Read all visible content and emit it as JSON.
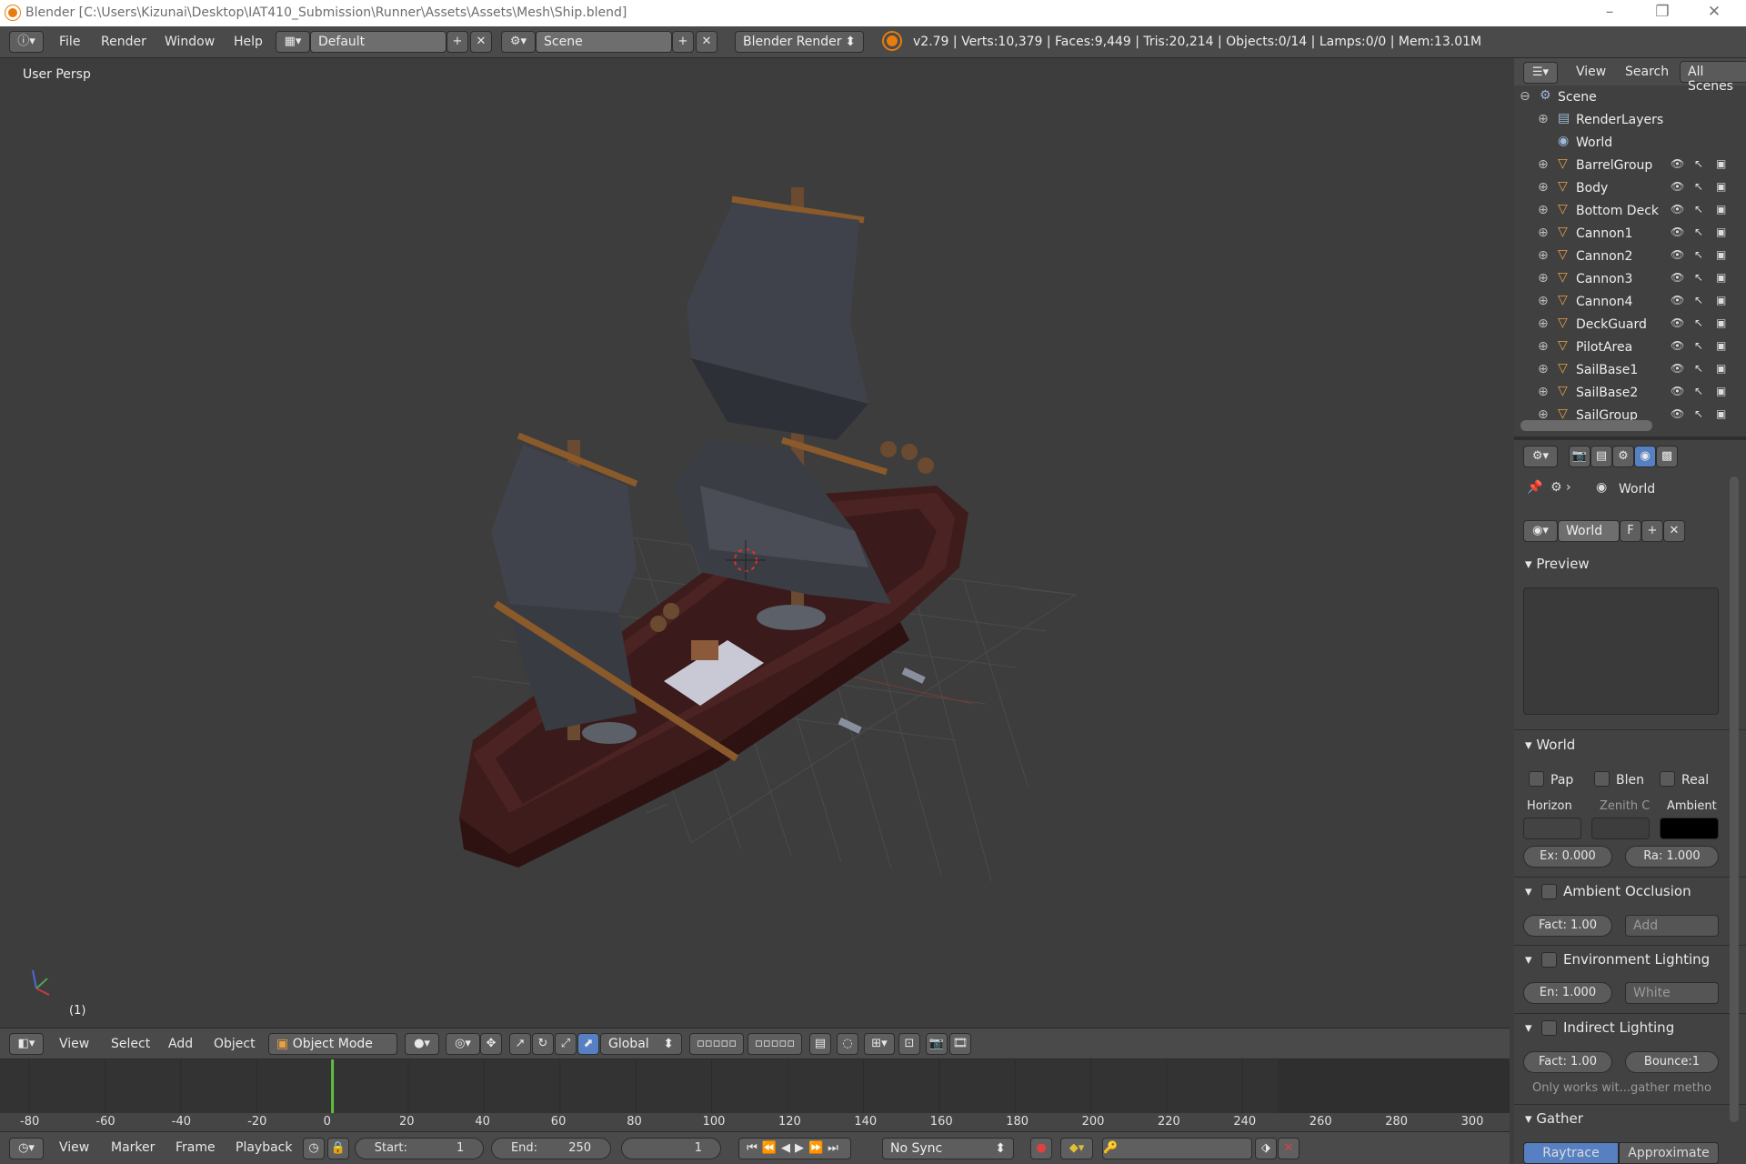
{
  "window": {
    "title": "Blender [C:\\Users\\Kizunai\\Desktop\\IAT410_Submission\\Runner\\Assets\\Assets\\Mesh\\Ship.blend]",
    "min": "–",
    "max": "❐",
    "close": "✕"
  },
  "menu": {
    "file": "File",
    "render": "Render",
    "window": "Window",
    "help": "Help"
  },
  "layout": {
    "screen": "Default",
    "scene": "Scene",
    "engine": "Blender Render"
  },
  "stats": "v2.79 | Verts:10,379 | Faces:9,449 | Tris:20,214 | Objects:0/14 | Lamps:0/0 | Mem:13.01M",
  "viewport": {
    "label": "User Persp",
    "frame": "(1)"
  },
  "vpheader": {
    "view": "View",
    "select": "Select",
    "add": "Add",
    "object": "Object",
    "mode": "Object Mode",
    "orientation": "Global"
  },
  "timeline": {
    "view": "View",
    "marker": "Marker",
    "frame": "Frame",
    "playback": "Playback",
    "start_label": "Start:",
    "start": "1",
    "end_label": "End:",
    "end": "250",
    "current": "1",
    "sync": "No Sync",
    "current_frame": 0,
    "ticks": [
      "-80",
      "-60",
      "-40",
      "-20",
      "0",
      "20",
      "40",
      "60",
      "80",
      "100",
      "120",
      "140",
      "160",
      "180",
      "200",
      "220",
      "240",
      "260",
      "280",
      "300"
    ]
  },
  "outliner": {
    "view": "View",
    "search": "Search",
    "filter": "All Scenes",
    "items": [
      {
        "label": "Scene",
        "type": "scene"
      },
      {
        "label": "RenderLayers",
        "type": "render"
      },
      {
        "label": "World",
        "type": "world"
      },
      {
        "label": "BarrelGroup",
        "type": "mesh"
      },
      {
        "label": "Body",
        "type": "mesh"
      },
      {
        "label": "Bottom Deck",
        "type": "mesh"
      },
      {
        "label": "Cannon1",
        "type": "mesh"
      },
      {
        "label": "Cannon2",
        "type": "mesh"
      },
      {
        "label": "Cannon3",
        "type": "mesh"
      },
      {
        "label": "Cannon4",
        "type": "mesh"
      },
      {
        "label": "DeckGuard",
        "type": "mesh"
      },
      {
        "label": "PilotArea",
        "type": "mesh"
      },
      {
        "label": "SailBase1",
        "type": "mesh"
      },
      {
        "label": "SailBase2",
        "type": "mesh"
      },
      {
        "label": "SailGroup",
        "type": "mesh"
      }
    ]
  },
  "properties": {
    "breadcrumb": "World",
    "world_block": "World",
    "fake_user": "F",
    "preview": "Preview",
    "world_panel": "World",
    "pap": "Pap",
    "blen": "Blen",
    "real": "Real",
    "horizon": "Horizon",
    "zenith": "Zenith C",
    "ambient": "Ambient",
    "exposure": "Ex: 0.000",
    "range": "Ra: 1.000",
    "ao": "Ambient Occlusion",
    "ao_fact": "Fact: 1.00",
    "ao_blend": "Add",
    "env": "Environment Lighting",
    "env_energy": "En: 1.000",
    "env_color": "White",
    "indirect": "Indirect Lighting",
    "ind_fact": "Fact: 1.00",
    "ind_bounce": "Bounce:1",
    "ind_note": "Only works wit...gather metho",
    "gather": "Gather",
    "raytrace": "Raytrace",
    "approximate": "Approximate"
  },
  "colors": {
    "horizon": "#434343",
    "zenith": "#3d3d3d",
    "ambient": "#000000",
    "accent": "#5680c2",
    "hull": "#4a2222",
    "sail": "#3c3f47"
  }
}
